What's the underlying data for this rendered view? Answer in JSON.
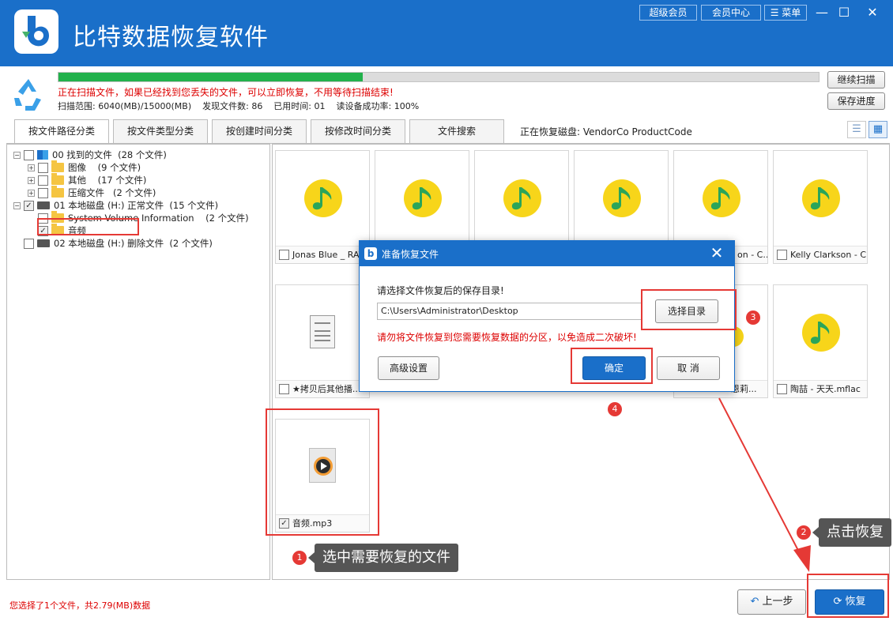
{
  "app": {
    "title": "比特数据恢复软件",
    "top_buttons": [
      "超级会员",
      "会员中心",
      "菜单"
    ],
    "accent": "#1a6fc9"
  },
  "scan": {
    "progress_percent": 40,
    "message": "正在扫描文件，如果已经找到您丢失的文件，可以立即恢复，不用等待扫描结束!",
    "stats": "扫描范围: 6040(MB)/15000(MB)    发现文件数: 86    已用时间: 01    读设备成功率: 100%",
    "continue_label": "继续扫描",
    "save_label": "保存进度"
  },
  "tabs": [
    "按文件路径分类",
    "按文件类型分类",
    "按创建时间分类",
    "按修改时间分类",
    "文件搜索"
  ],
  "disk_label": "正在恢复磁盘: VendorCo ProductCode",
  "tree": [
    {
      "label": "00 找到的文件  (28 个文件)"
    },
    {
      "label": "图像    (9 个文件)"
    },
    {
      "label": "其他    (17 个文件)"
    },
    {
      "label": "压缩文件   (2 个文件)"
    },
    {
      "label": "01 本地磁盘 (H:) 正常文件  (15 个文件)"
    },
    {
      "label": "System Volume Information    (2 个文件)"
    },
    {
      "label": "音频"
    },
    {
      "label": "02 本地磁盘 (H:) 删除文件  (2 个文件)"
    }
  ],
  "files": [
    {
      "name": "Jonas Blue _ RAYE"
    },
    {
      "name": ""
    },
    {
      "name": ""
    },
    {
      "name": ""
    },
    {
      "name": "on - C..."
    },
    {
      "name": "Kelly Clarkson - C..."
    },
    {
      "name": "★拷贝后其他播..."
    },
    {
      "name": "恩莉..."
    },
    {
      "name": "陶喆 - 天天.mflac"
    },
    {
      "name": "音频.mp3"
    }
  ],
  "dialog": {
    "title": "准备恢复文件",
    "prompt": "请选择文件恢复后的保存目录!",
    "path": "C:\\Users\\Administrator\\Desktop",
    "choose_dir": "选择目录",
    "warning": "请勿将文件恢复到您需要恢复数据的分区，以免造成二次破坏!",
    "advanced": "高级设置",
    "ok": "确定",
    "cancel": "取 消"
  },
  "annotations": {
    "step1": "1",
    "step1_text": "选中需要恢复的文件",
    "step2": "2",
    "step2_text": "点击恢复",
    "step3": "3",
    "step4": "4"
  },
  "bottom": {
    "status": "您选择了1个文件，共2.79(MB)数据",
    "back": "上一步",
    "recover": "恢复"
  }
}
